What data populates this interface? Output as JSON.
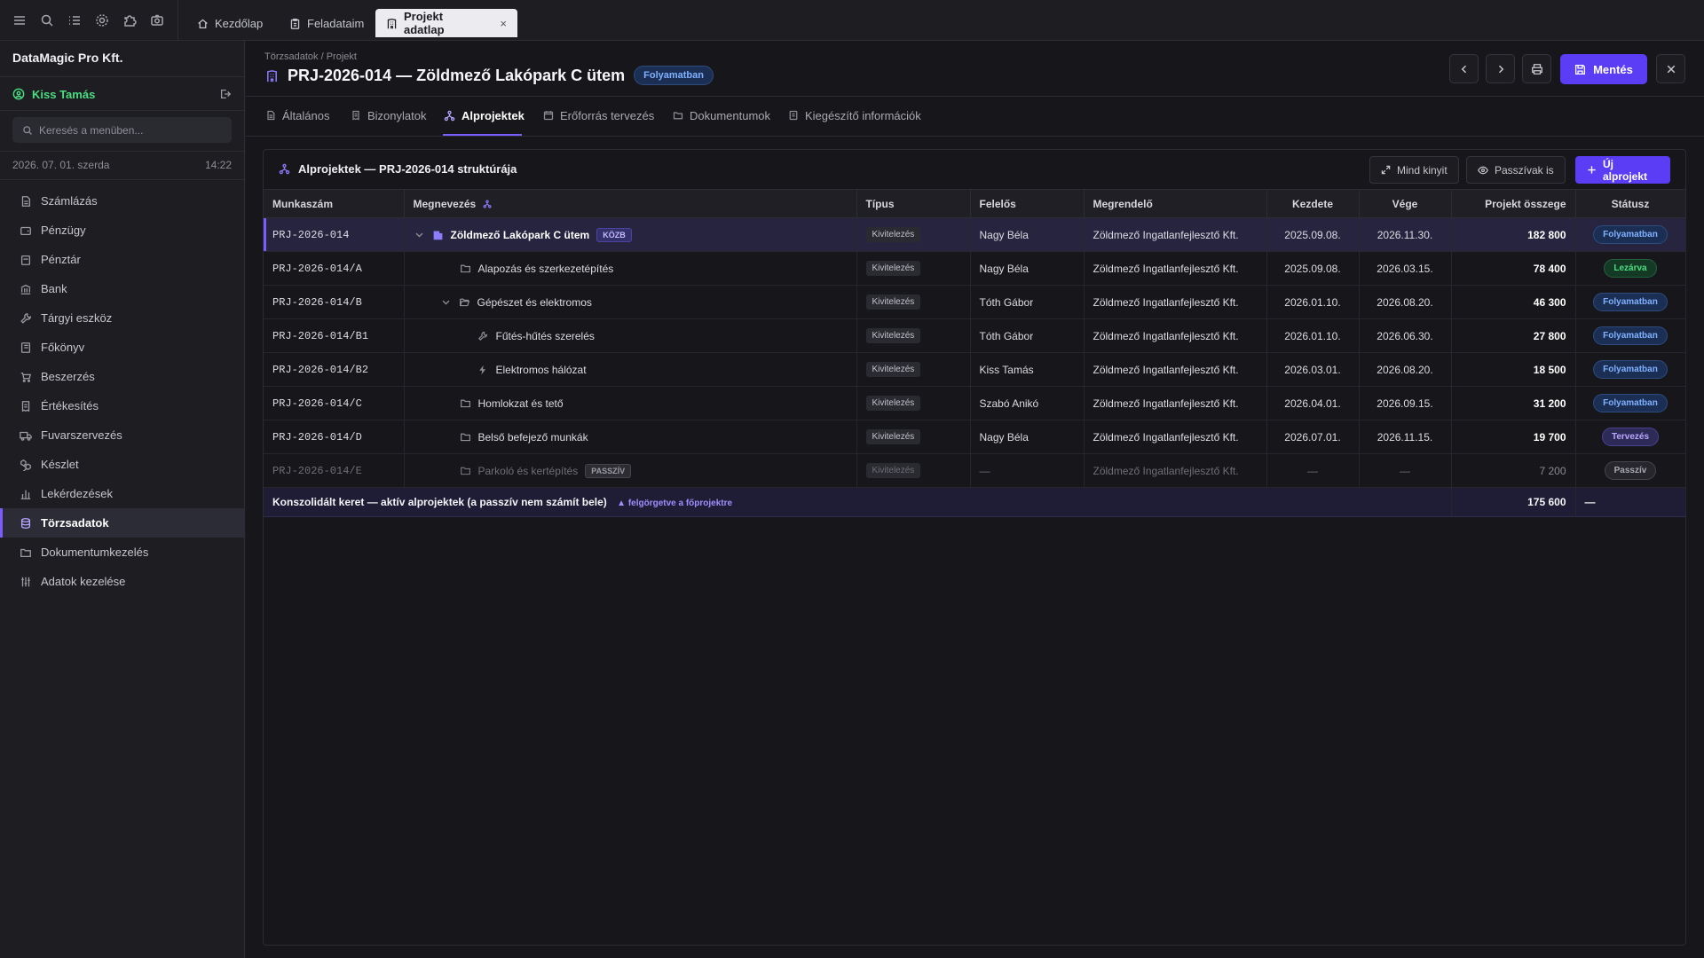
{
  "topbar": {
    "tabs": [
      {
        "label": "Kezdőlap",
        "icon": "home-icon"
      },
      {
        "label": "Feladataim",
        "icon": "clipboard-icon"
      },
      {
        "label": "Projekt adatlap",
        "icon": "building-icon",
        "active": true,
        "close": "×"
      }
    ]
  },
  "sidebar": {
    "company": "DataMagic Pro Kft.",
    "user": "Kiss Tamás",
    "search_placeholder": "Keresés a menüben...",
    "date": "2026. 07. 01. szerda",
    "time": "14:22",
    "items": [
      {
        "label": "Számlázás",
        "icon": "invoice-icon"
      },
      {
        "label": "Pénzügy",
        "icon": "wallet-icon"
      },
      {
        "label": "Pénztár",
        "icon": "cashbox-icon"
      },
      {
        "label": "Bank",
        "icon": "bank-icon"
      },
      {
        "label": "Tárgyi eszköz",
        "icon": "wrench-icon"
      },
      {
        "label": "Főkönyv",
        "icon": "ledger-icon"
      },
      {
        "label": "Beszerzés",
        "icon": "cart-icon"
      },
      {
        "label": "Értékesítés",
        "icon": "receipt-icon"
      },
      {
        "label": "Fuvarszervezés",
        "icon": "truck-icon"
      },
      {
        "label": "Készlet",
        "icon": "boxes-icon"
      },
      {
        "label": "Lekérdezések",
        "icon": "chart-icon"
      },
      {
        "label": "Törzsadatok",
        "icon": "database-icon",
        "active": true
      },
      {
        "label": "Dokumentumkezelés",
        "icon": "folder-icon"
      },
      {
        "label": "Adatok kezelése",
        "icon": "sliders-icon"
      }
    ]
  },
  "header": {
    "breadcrumb": "Törzsadatok / Projekt",
    "title": "PRJ-2026-014 — Zöldmező Lakópark C ütem",
    "status": "Folyamatban",
    "save_label": "Mentés"
  },
  "subtabs": [
    {
      "label": "Általános",
      "icon": "document-icon"
    },
    {
      "label": "Bizonylatok",
      "icon": "receipt-icon"
    },
    {
      "label": "Alprojektek",
      "icon": "hierarchy-icon",
      "active": true
    },
    {
      "label": "Erőforrás tervezés",
      "icon": "calendar-icon"
    },
    {
      "label": "Dokumentumok",
      "icon": "folder-icon"
    },
    {
      "label": "Kiegészítő információk",
      "icon": "info-doc-icon"
    }
  ],
  "panel": {
    "title": "Alprojektek — PRJ-2026-014 struktúrája",
    "expand_label": "Mind kinyit",
    "passive_label": "Passzívak is",
    "new_label": "Új alprojekt"
  },
  "table": {
    "headers": [
      "Munkaszám",
      "Megnevezés",
      "Típus",
      "Felelős",
      "Megrendelő",
      "Kezdete",
      "Vége",
      "Projekt összege",
      "Státusz"
    ],
    "rows": [
      {
        "code": "PRJ-2026-014",
        "name": "Zöldmező Lakópark C ütem",
        "tag": "KÖZB",
        "type": "Kivitelezés",
        "owner": "Nagy Béla",
        "client": "Zöldmező Ingatlanfejlesztő Kft.",
        "start": "2025.09.08.",
        "end": "2026.11.30.",
        "amount": "182 800",
        "status": "Folyamatban"
      },
      {
        "code": "PRJ-2026-014/A",
        "name": "Alapozás és szerkezetépítés",
        "type": "Kivitelezés",
        "owner": "Nagy Béla",
        "client": "Zöldmező Ingatlanfejlesztő Kft.",
        "start": "2025.09.08.",
        "end": "2026.03.15.",
        "amount": "78 400",
        "status": "Lezárva"
      },
      {
        "code": "PRJ-2026-014/B",
        "name": "Gépészet és elektromos",
        "type": "Kivitelezés",
        "owner": "Tóth Gábor",
        "client": "Zöldmező Ingatlanfejlesztő Kft.",
        "start": "2026.01.10.",
        "end": "2026.08.20.",
        "amount": "46 300",
        "status": "Folyamatban"
      },
      {
        "code": "PRJ-2026-014/B1",
        "name": "Fűtés-hűtés szerelés",
        "type": "Kivitelezés",
        "owner": "Tóth Gábor",
        "client": "Zöldmező Ingatlanfejlesztő Kft.",
        "start": "2026.01.10.",
        "end": "2026.06.30.",
        "amount": "27 800",
        "status": "Folyamatban"
      },
      {
        "code": "PRJ-2026-014/B2",
        "name": "Elektromos hálózat",
        "type": "Kivitelezés",
        "owner": "Kiss Tamás",
        "client": "Zöldmező Ingatlanfejlesztő Kft.",
        "start": "2026.03.01.",
        "end": "2026.08.20.",
        "amount": "18 500",
        "status": "Folyamatban"
      },
      {
        "code": "PRJ-2026-014/C",
        "name": "Homlokzat és tető",
        "type": "Kivitelezés",
        "owner": "Szabó Anikó",
        "client": "Zöldmező Ingatlanfejlesztő Kft.",
        "start": "2026.04.01.",
        "end": "2026.09.15.",
        "amount": "31 200",
        "status": "Folyamatban"
      },
      {
        "code": "PRJ-2026-014/D",
        "name": "Belső befejező munkák",
        "type": "Kivitelezés",
        "owner": "Nagy Béla",
        "client": "Zöldmező Ingatlanfejlesztő Kft.",
        "start": "2026.07.01.",
        "end": "2026.11.15.",
        "amount": "19 700",
        "status": "Tervezés"
      },
      {
        "code": "PRJ-2026-014/E",
        "name": "Parkoló és kertépítés",
        "tag": "PASSZÍV",
        "type": "Kivitelezés",
        "owner": "—",
        "client": "Zöldmező Ingatlanfejlesztő Kft.",
        "start": "—",
        "end": "—",
        "amount": "7 200",
        "status": "Passzív"
      }
    ],
    "total": {
      "label": "Konszolidált keret — aktív alprojektek (a passzív nem számít bele)",
      "note": "▲ felgörgetve a főprojektre",
      "amount": "175 600",
      "status": "—"
    }
  },
  "colors": {
    "accent": "#5b3df5",
    "user": "#4ade80",
    "total": "#facc15"
  }
}
